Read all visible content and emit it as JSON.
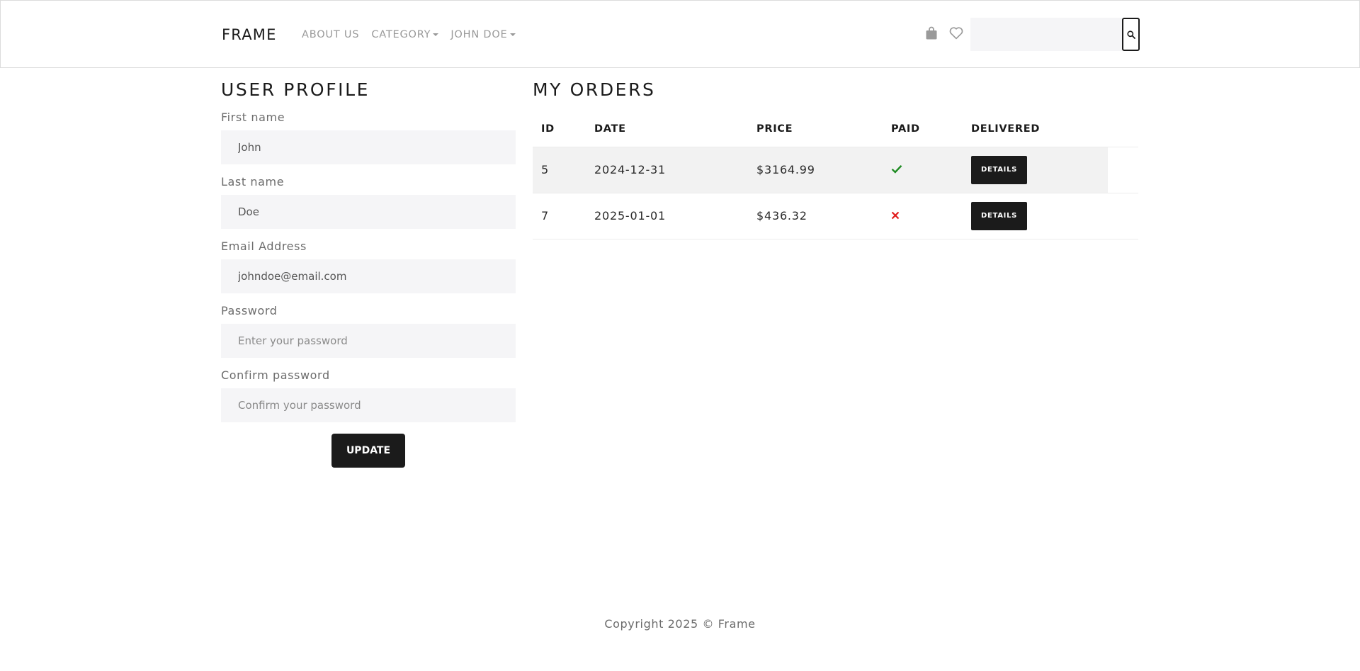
{
  "navbar": {
    "brand": "FRAME",
    "links": [
      {
        "label": "ABOUT US",
        "dropdown": false
      },
      {
        "label": "CATEGORY",
        "dropdown": true
      },
      {
        "label": "JOHN DOE",
        "dropdown": true
      }
    ],
    "icons": [
      "shopping-bag-icon",
      "heart-icon"
    ],
    "search": {
      "value": "",
      "placeholder": ""
    }
  },
  "profile": {
    "title": "USER PROFILE",
    "fields": [
      {
        "label": "First name",
        "value": "John",
        "placeholder": ""
      },
      {
        "label": "Last name",
        "value": "Doe",
        "placeholder": ""
      },
      {
        "label": "Email Address",
        "value": "johndoe@email.com",
        "placeholder": ""
      },
      {
        "label": "Password",
        "value": "",
        "placeholder": "Enter your password"
      },
      {
        "label": "Confirm password",
        "value": "",
        "placeholder": "Confirm your password"
      }
    ],
    "update_label": "UPDATE"
  },
  "orders": {
    "title": "MY ORDERS",
    "columns": [
      "ID",
      "DATE",
      "PRICE",
      "PAID",
      "DELIVERED"
    ],
    "rows": [
      {
        "id": "5",
        "date": "2024-12-31",
        "price": "$3164.99",
        "paid": true,
        "details_label": "DETAILS"
      },
      {
        "id": "7",
        "date": "2025-01-01",
        "price": "$436.32",
        "paid": false,
        "details_label": "DETAILS"
      }
    ]
  },
  "colors": {
    "primary": "#1b1b1b",
    "muted": "#999999",
    "input_bg": "#f5f5f7",
    "row_stripe": "#f2f2f2",
    "paid_yes": "#1e8b22",
    "paid_no": "#e11b1b"
  },
  "footer": {
    "text": "Copyright 2025 © Frame"
  }
}
